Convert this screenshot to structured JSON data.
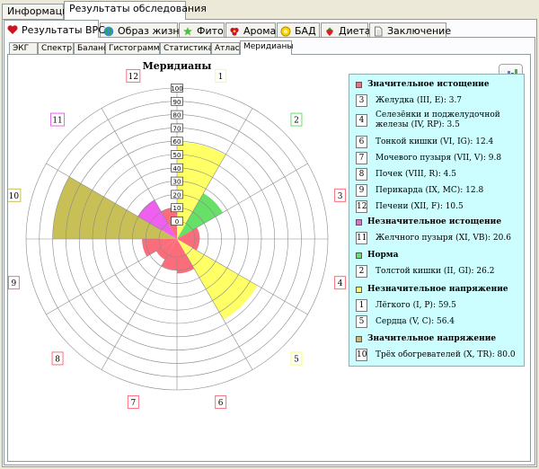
{
  "top_tabs": [
    "Информация",
    "Результаты обследования"
  ],
  "main_tabs": [
    {
      "label": "Результаты ВРС",
      "icon": "heart-icon"
    },
    {
      "label": "Образ жизни",
      "icon": "globe-icon"
    },
    {
      "label": "Фито",
      "icon": "leaf-icon"
    },
    {
      "label": "Арома",
      "icon": "flower-icon"
    },
    {
      "label": "БАД",
      "icon": "pill-icon"
    },
    {
      "label": "Диета",
      "icon": "strawberry-icon"
    },
    {
      "label": "Заключение",
      "icon": "document-icon"
    }
  ],
  "sub_tabs": [
    "ЭКГ",
    "Спектр",
    "Баланс",
    "Гистограмма",
    "Статистика",
    "Атлас",
    "Меридианы"
  ],
  "chart_data": {
    "type": "polar-bar",
    "title": "Меридианы",
    "r_ticks": [
      "0",
      "10",
      "20",
      "30",
      "40",
      "50",
      "60",
      "70",
      "80",
      "90",
      "100"
    ],
    "rmax": 100,
    "sectors": [
      {
        "label": "1",
        "value": 59.5,
        "color": "#ffff66"
      },
      {
        "label": "2",
        "value": 26.2,
        "color": "#66e066"
      },
      {
        "label": "3",
        "value": 3.7,
        "color": "#fb6d7b"
      },
      {
        "label": "4",
        "value": 3.5,
        "color": "#fb6d7b"
      },
      {
        "label": "5",
        "value": 56.4,
        "color": "#ffff66"
      },
      {
        "label": "6",
        "value": 12.4,
        "color": "#fb6d7b"
      },
      {
        "label": "7",
        "value": 9.8,
        "color": "#fb6d7b"
      },
      {
        "label": "8",
        "value": 4.5,
        "color": "#fb6d7b"
      },
      {
        "label": "9",
        "value": 12.8,
        "color": "#fb6d7b"
      },
      {
        "label": "10",
        "value": 80.0,
        "color": "#c8c057"
      },
      {
        "label": "11",
        "value": 20.6,
        "color": "#ef5ff0"
      },
      {
        "label": "12",
        "value": 10.5,
        "color": "#fb6d7b"
      }
    ]
  },
  "legend": [
    {
      "heading": "Значительное истощение",
      "color": "#fb6d7b",
      "items": [
        {
          "num": "3",
          "text": "Желудка (III, E): 3.7"
        },
        {
          "num": "4",
          "text": "Селезёнки и поджелудочной железы (IV, RP): 3.5"
        },
        {
          "num": "6",
          "text": "Тонкой кишки (VI, IG): 12.4"
        },
        {
          "num": "7",
          "text": "Мочевого пузыря (VII, V): 9.8"
        },
        {
          "num": "8",
          "text": "Почек (VIII, R): 4.5"
        },
        {
          "num": "9",
          "text": "Перикарда (IX, MC): 12.8"
        },
        {
          "num": "12",
          "text": "Печени (XII, F): 10.5"
        }
      ]
    },
    {
      "heading": "Незначительное истощение",
      "color": "#ef5ff0",
      "items": [
        {
          "num": "11",
          "text": "Желчного пузыря (XI, VB): 20.6"
        }
      ]
    },
    {
      "heading": "Норма",
      "color": "#66e066",
      "items": [
        {
          "num": "2",
          "text": "Толстой кишки (II, GI): 26.2"
        }
      ]
    },
    {
      "heading": "Незначительное напряжение",
      "color": "#ffff66",
      "items": [
        {
          "num": "1",
          "text": "Лёгкого (I, P): 59.5"
        },
        {
          "num": "5",
          "text": "Сердца (V, C): 56.4"
        }
      ]
    },
    {
      "heading": "Значительное напряжение",
      "color": "#c8c057",
      "items": [
        {
          "num": "10",
          "text": "Трёх обогревателей (X, TR): 80.0"
        }
      ]
    }
  ],
  "colors": {
    "legend_bg": "#cdfeff",
    "panel_border": "#919b9c"
  }
}
